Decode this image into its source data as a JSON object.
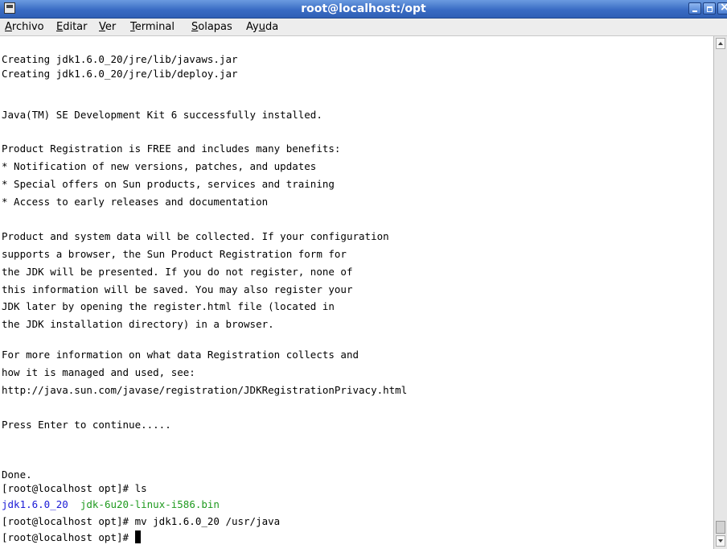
{
  "window": {
    "title": "root@localhost:/opt"
  },
  "menu": [
    {
      "mn": "A",
      "rest": "rchivo"
    },
    {
      "mn": "E",
      "rest": "ditar"
    },
    {
      "mn": "V",
      "rest": "er"
    },
    {
      "mn": "T",
      "rest": "erminal"
    },
    {
      "mn": "S",
      "rest": "olapas"
    },
    {
      "pre": "Ay",
      "mn": "u",
      "rest": "da"
    }
  ],
  "terminal": {
    "lines": [
      "Creating jdk1.6.0_20/jre/lib/javaws.jar",
      "Creating jdk1.6.0_20/jre/lib/deploy.jar",
      "",
      "Java(TM) SE Development Kit 6 successfully installed.",
      "",
      "Product Registration is FREE and includes many benefits:",
      "* Notification of new versions, patches, and updates",
      "* Special offers on Sun products, services and training",
      "* Access to early releases and documentation",
      "",
      "Product and system data will be collected. If your configuration",
      "supports a browser, the Sun Product Registration form for",
      "the JDK will be presented. If you do not register, none of",
      "this information will be saved. You may also register your",
      "JDK later by opening the register.html file (located in",
      "the JDK installation directory) in a browser.",
      "",
      "For more information on what data Registration collects and",
      "how it is managed and used, see:",
      "http://java.sun.com/javase/registration/JDKRegistrationPrivacy.html",
      "",
      "Press Enter to continue.....",
      "",
      "",
      "Done.",
      "[root@localhost opt]# ls"
    ],
    "ls_dir": "jdk1.6.0_20",
    "ls_file": "jdk-6u20-linux-i586.bin",
    "cmd_mv": "[root@localhost opt]# mv jdk1.6.0_20 /usr/java",
    "prompt": "[root@localhost opt]# ",
    "colors": {
      "directory": "#1a1ad6",
      "executable": "#1f9a1f",
      "titlebar": "#3a6cc4"
    }
  }
}
